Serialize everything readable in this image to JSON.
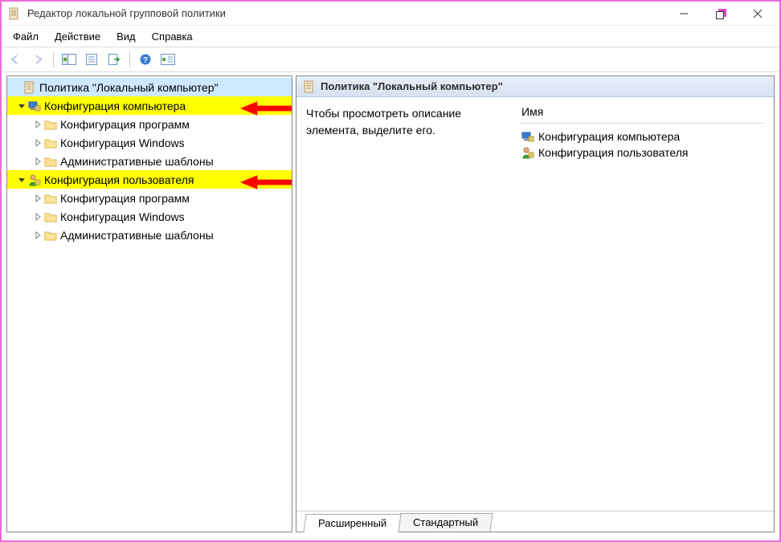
{
  "window": {
    "title": "Редактор локальной групповой политики"
  },
  "menu": {
    "file": "Файл",
    "action": "Действие",
    "view": "Вид",
    "help": "Справка"
  },
  "tree": {
    "root": "Политика \"Локальный компьютер\"",
    "computer_cfg": "Конфигурация компьютера",
    "user_cfg": "Конфигурация пользователя",
    "soft_cfg": "Конфигурация программ",
    "win_cfg": "Конфигурация Windows",
    "admin_tmpl": "Административные шаблоны"
  },
  "right": {
    "header": "Политика \"Локальный компьютер\"",
    "description": "Чтобы просмотреть описание элемента, выделите его.",
    "name_column": "Имя",
    "items": {
      "computer": "Конфигурация компьютера",
      "user": "Конфигурация пользователя"
    }
  },
  "tabs": {
    "extended": "Расширенный",
    "standard": "Стандартный"
  }
}
